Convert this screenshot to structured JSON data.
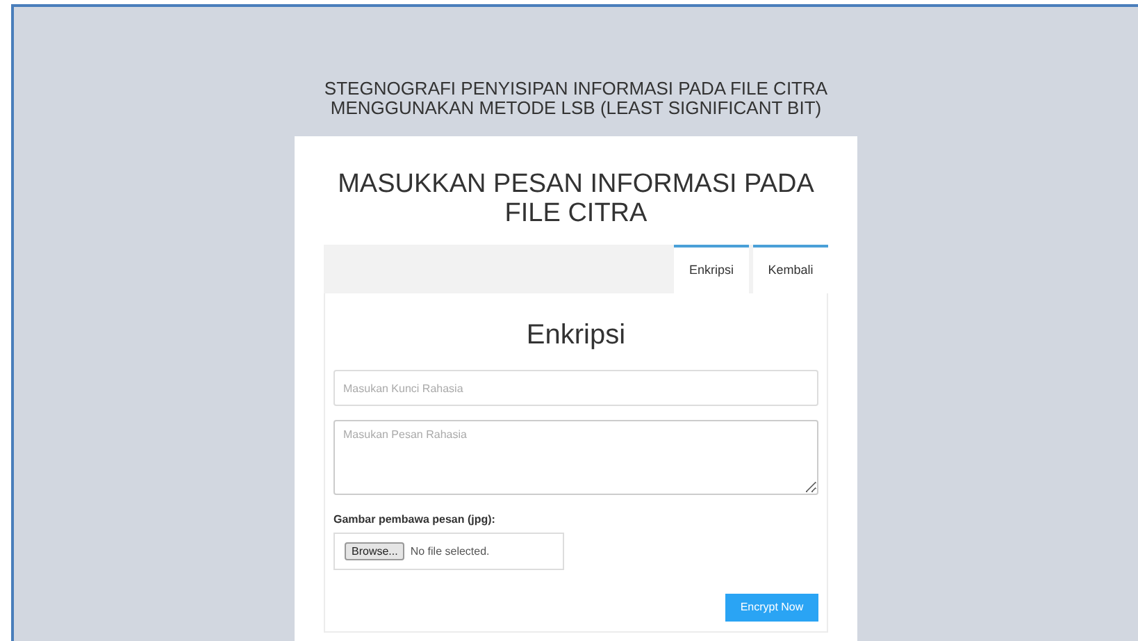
{
  "page_title_lines": [
    "STEGNOGRAFI PENYISIPAN INFORMASI PADA FILE CITRA",
    "MENGGUNAKAN METODE LSB (LEAST SIGNIFICANT BIT)"
  ],
  "card_title": "MASUKKAN PESAN INFORMASI PADA FILE CITRA",
  "tabs": [
    {
      "label": "Enkripsi"
    },
    {
      "label": "Kembali"
    }
  ],
  "form": {
    "heading": "Enkripsi",
    "key_field": {
      "placeholder": "Masukan Kunci Rahasia"
    },
    "message_field": {
      "placeholder": "Masukan Pesan Rahasia"
    },
    "file_label": "Gambar pembawa pesan (jpg):",
    "browse_button": "Browse...",
    "file_status": "No file selected.",
    "submit_button": "Encrypt Now"
  }
}
